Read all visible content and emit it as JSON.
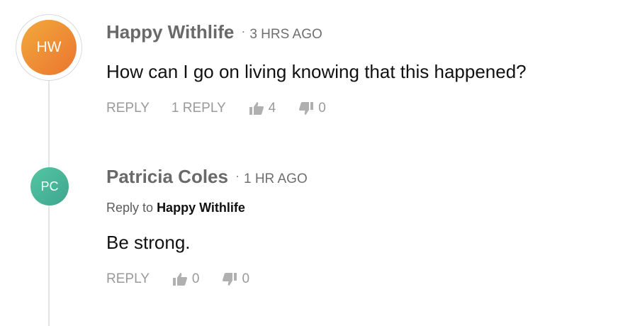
{
  "comments": [
    {
      "avatar_initials": "HW",
      "author": "Happy Withlife",
      "separator": "·",
      "time": "3 HRS AGO",
      "text": "How can I go on living knowing that this happened?",
      "reply_label": "REPLY",
      "replies_label": "1 REPLY",
      "likes": "4",
      "dislikes": "0"
    },
    {
      "avatar_initials": "PC",
      "author": "Patricia Coles",
      "separator": "·",
      "time": "1 HR AGO",
      "reply_to_prefix": "Reply to",
      "reply_to_author": "Happy Withlife",
      "text": "Be strong.",
      "reply_label": "REPLY",
      "likes": "0",
      "dislikes": "0"
    }
  ],
  "colors": {
    "avatar_main": "#ea7530",
    "avatar_reply": "#3fa58f",
    "author": "#696969",
    "action": "#9a9a9a"
  },
  "icons": [
    "thumbs-up-icon",
    "thumbs-down-icon"
  ]
}
